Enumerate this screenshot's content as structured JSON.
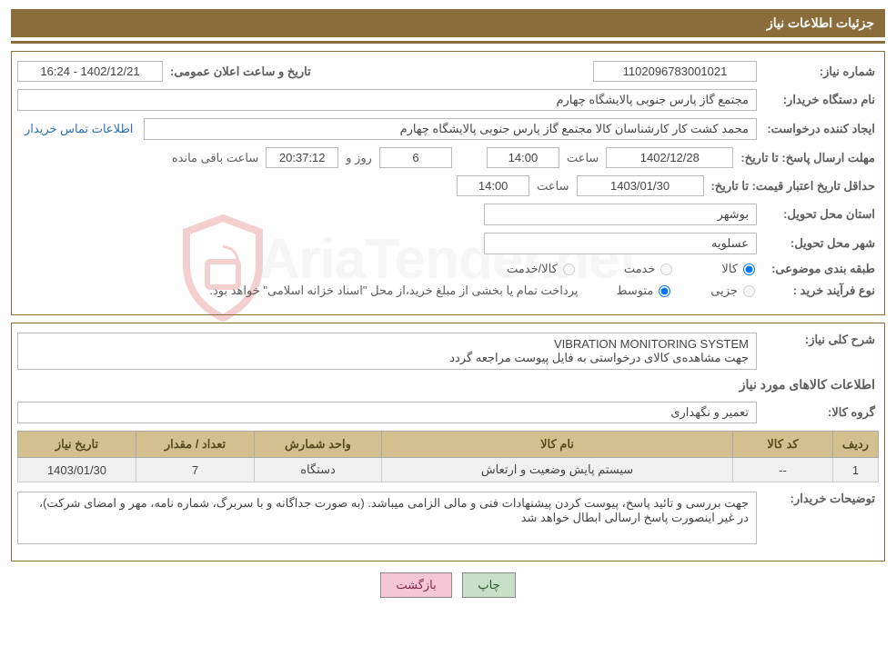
{
  "header": {
    "title": "جزئیات اطلاعات نیاز"
  },
  "fields": {
    "need_number_label": "شماره نیاز:",
    "need_number": "1102096783001021",
    "announce_date_label": "تاریخ و ساعت اعلان عمومی:",
    "announce_date": "1402/12/21 - 16:24",
    "buyer_org_label": "نام دستگاه خریدار:",
    "buyer_org": "مجتمع گاز پارس جنوبی  پالایشگاه چهارم",
    "requester_label": "ایجاد کننده درخواست:",
    "requester": "محمد کشت کار کارشناسان کالا مجتمع گاز پارس جنوبی  پالایشگاه چهارم",
    "contact_link": "اطلاعات تماس خریدار",
    "deadline_label": "مهلت ارسال پاسخ:",
    "deadline_to": "تا تاریخ:",
    "deadline_date": "1402/12/28",
    "time_word": "ساعت",
    "deadline_time": "14:00",
    "days_count": "6",
    "days_and": "روز و",
    "hours_count": "20:37:12",
    "remaining": "ساعت باقی مانده",
    "price_validity_label": "حداقل تاریخ اعتبار قیمت:",
    "price_validity_to": "تا تاریخ:",
    "price_validity_date": "1403/01/30",
    "price_validity_time": "14:00",
    "province_label": "استان محل تحویل:",
    "province": "بوشهر",
    "city_label": "شهر محل تحویل:",
    "city": "عسلویه",
    "category_label": "طبقه بندی موضوعی:",
    "radio_goods": "کالا",
    "radio_service": "خدمت",
    "radio_goods_service": "کالا/خدمت",
    "purchase_type_label": "نوع فرآیند خرید :",
    "radio_partial": "جزیی",
    "radio_medium": "متوسط",
    "payment_note": "پرداخت تمام یا بخشی از مبلغ خرید،از محل \"اسناد خزانه اسلامی\" خواهد بود.",
    "desc_label": "شرح کلی نیاز:",
    "desc_line1": "VIBRATION MONITORING SYSTEM",
    "desc_line2": "جهت مشاهده‌ی کالای درخواستی به فایل پیوست مراجعه گردد",
    "goods_info_title": "اطلاعات کالاهای مورد نیاز",
    "group_label": "گروه کالا:",
    "group_value": "تعمیر و نگهداری",
    "buyer_notes_label": "توضیحات خریدار:",
    "buyer_notes": "جهت بررسی و تائید پاسخ، پیوست کردن پیشنهادات فنی و مالی الزامی میباشد. (به صورت جداگانه و با سربرگ، شماره نامه، مهر و امضای شرکت)، در غیر اینصورت پاسخ ارسالی ابطال خواهد شد"
  },
  "table": {
    "headers": {
      "row": "ردیف",
      "code": "کد کالا",
      "name": "نام کالا",
      "unit": "واحد شمارش",
      "qty": "تعداد / مقدار",
      "date": "تاریخ نیاز"
    },
    "rows": [
      {
        "row": "1",
        "code": "--",
        "name": "سیستم پایش وضعیت و ارتعاش",
        "unit": "دستگاه",
        "qty": "7",
        "date": "1403/01/30"
      }
    ]
  },
  "buttons": {
    "print": "چاپ",
    "back": "بازگشت"
  },
  "watermark": "AriaTender.net"
}
